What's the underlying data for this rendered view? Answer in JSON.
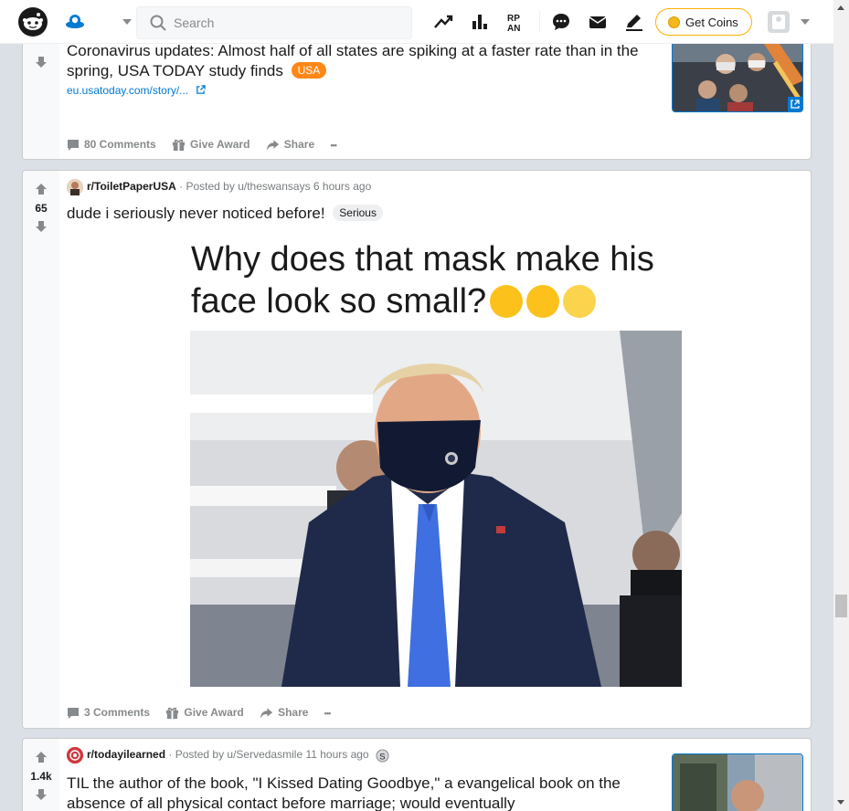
{
  "header": {
    "search_placeholder": "Search",
    "coins_label": "Get Coins",
    "accent": "#0079d3",
    "coin_border": "#ffb000"
  },
  "posts": [
    {
      "score": "",
      "title": "Coronavirus updates: Almost half of all states are spiking at a faster rate than in the spring, USA TODAY study finds",
      "flair": "USA",
      "link": "eu.usatoday.com/story/...",
      "comments": "80 Comments",
      "award": "Give Award",
      "share": "Share",
      "more": "•••"
    },
    {
      "subreddit": "r/ToiletPaperUSA",
      "posted_by": "· Posted by u/theswansays 6 hours ago",
      "score": "65",
      "title": "dude i seriously never noticed before!",
      "flair": "Serious",
      "meme_caption": "Why does that mask make his face look so small?",
      "comments": "3 Comments",
      "award": "Give Award",
      "share": "Share",
      "more": "•••"
    },
    {
      "subreddit": "r/todayilearned",
      "posted_by": "· Posted by u/Servedasmile 11 hours ago",
      "score": "1.4k",
      "title": "TIL the author of the book, \"I Kissed Dating Goodbye,\" a evangelical book on the absence of all physical contact before marriage; would eventually"
    }
  ],
  "icons": [
    "reddit-logo-icon",
    "home-icon",
    "search-icon",
    "trending-icon",
    "stats-icon",
    "rpan-icon",
    "chat-icon",
    "mail-icon",
    "pencil-icon",
    "coin-icon",
    "upvote-icon",
    "downvote-icon",
    "comment-icon",
    "gift-icon",
    "share-icon",
    "external-link-icon"
  ]
}
